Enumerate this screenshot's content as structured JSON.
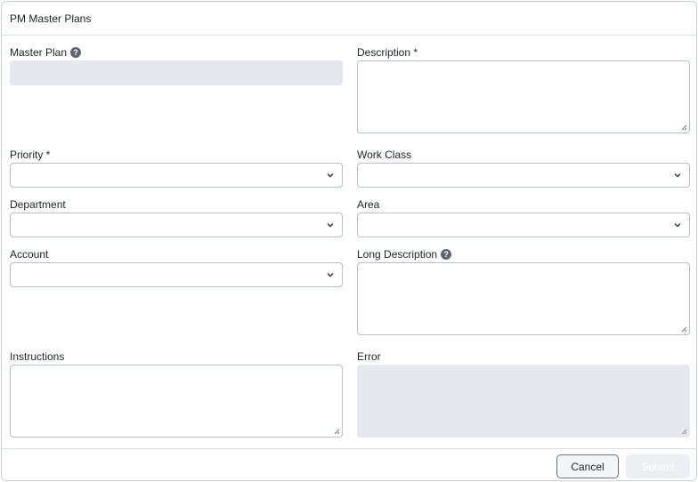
{
  "dialog": {
    "title": "PM Master Plans"
  },
  "fields": {
    "master_plan": {
      "label": "Master Plan",
      "value": ""
    },
    "description": {
      "label": "Description *",
      "value": ""
    },
    "priority": {
      "label": "Priority *",
      "value": ""
    },
    "work_class": {
      "label": "Work Class",
      "value": ""
    },
    "department": {
      "label": "Department",
      "value": ""
    },
    "area": {
      "label": "Area",
      "value": ""
    },
    "account": {
      "label": "Account",
      "value": ""
    },
    "long_description": {
      "label": "Long Description",
      "value": ""
    },
    "instructions": {
      "label": "Instructions",
      "value": ""
    },
    "error": {
      "label": "Error",
      "value": ""
    }
  },
  "footer": {
    "cancel_label": "Cancel",
    "submit_label": "Submit"
  },
  "icons": {
    "help": "question-circle-icon",
    "dropdown": "chevron-down-icon",
    "resize": "resize-handle-icon"
  },
  "colors": {
    "disabled_field_bg": "#e6e8ee",
    "border": "#b9bec6",
    "help_icon_bg": "#5d6570"
  }
}
